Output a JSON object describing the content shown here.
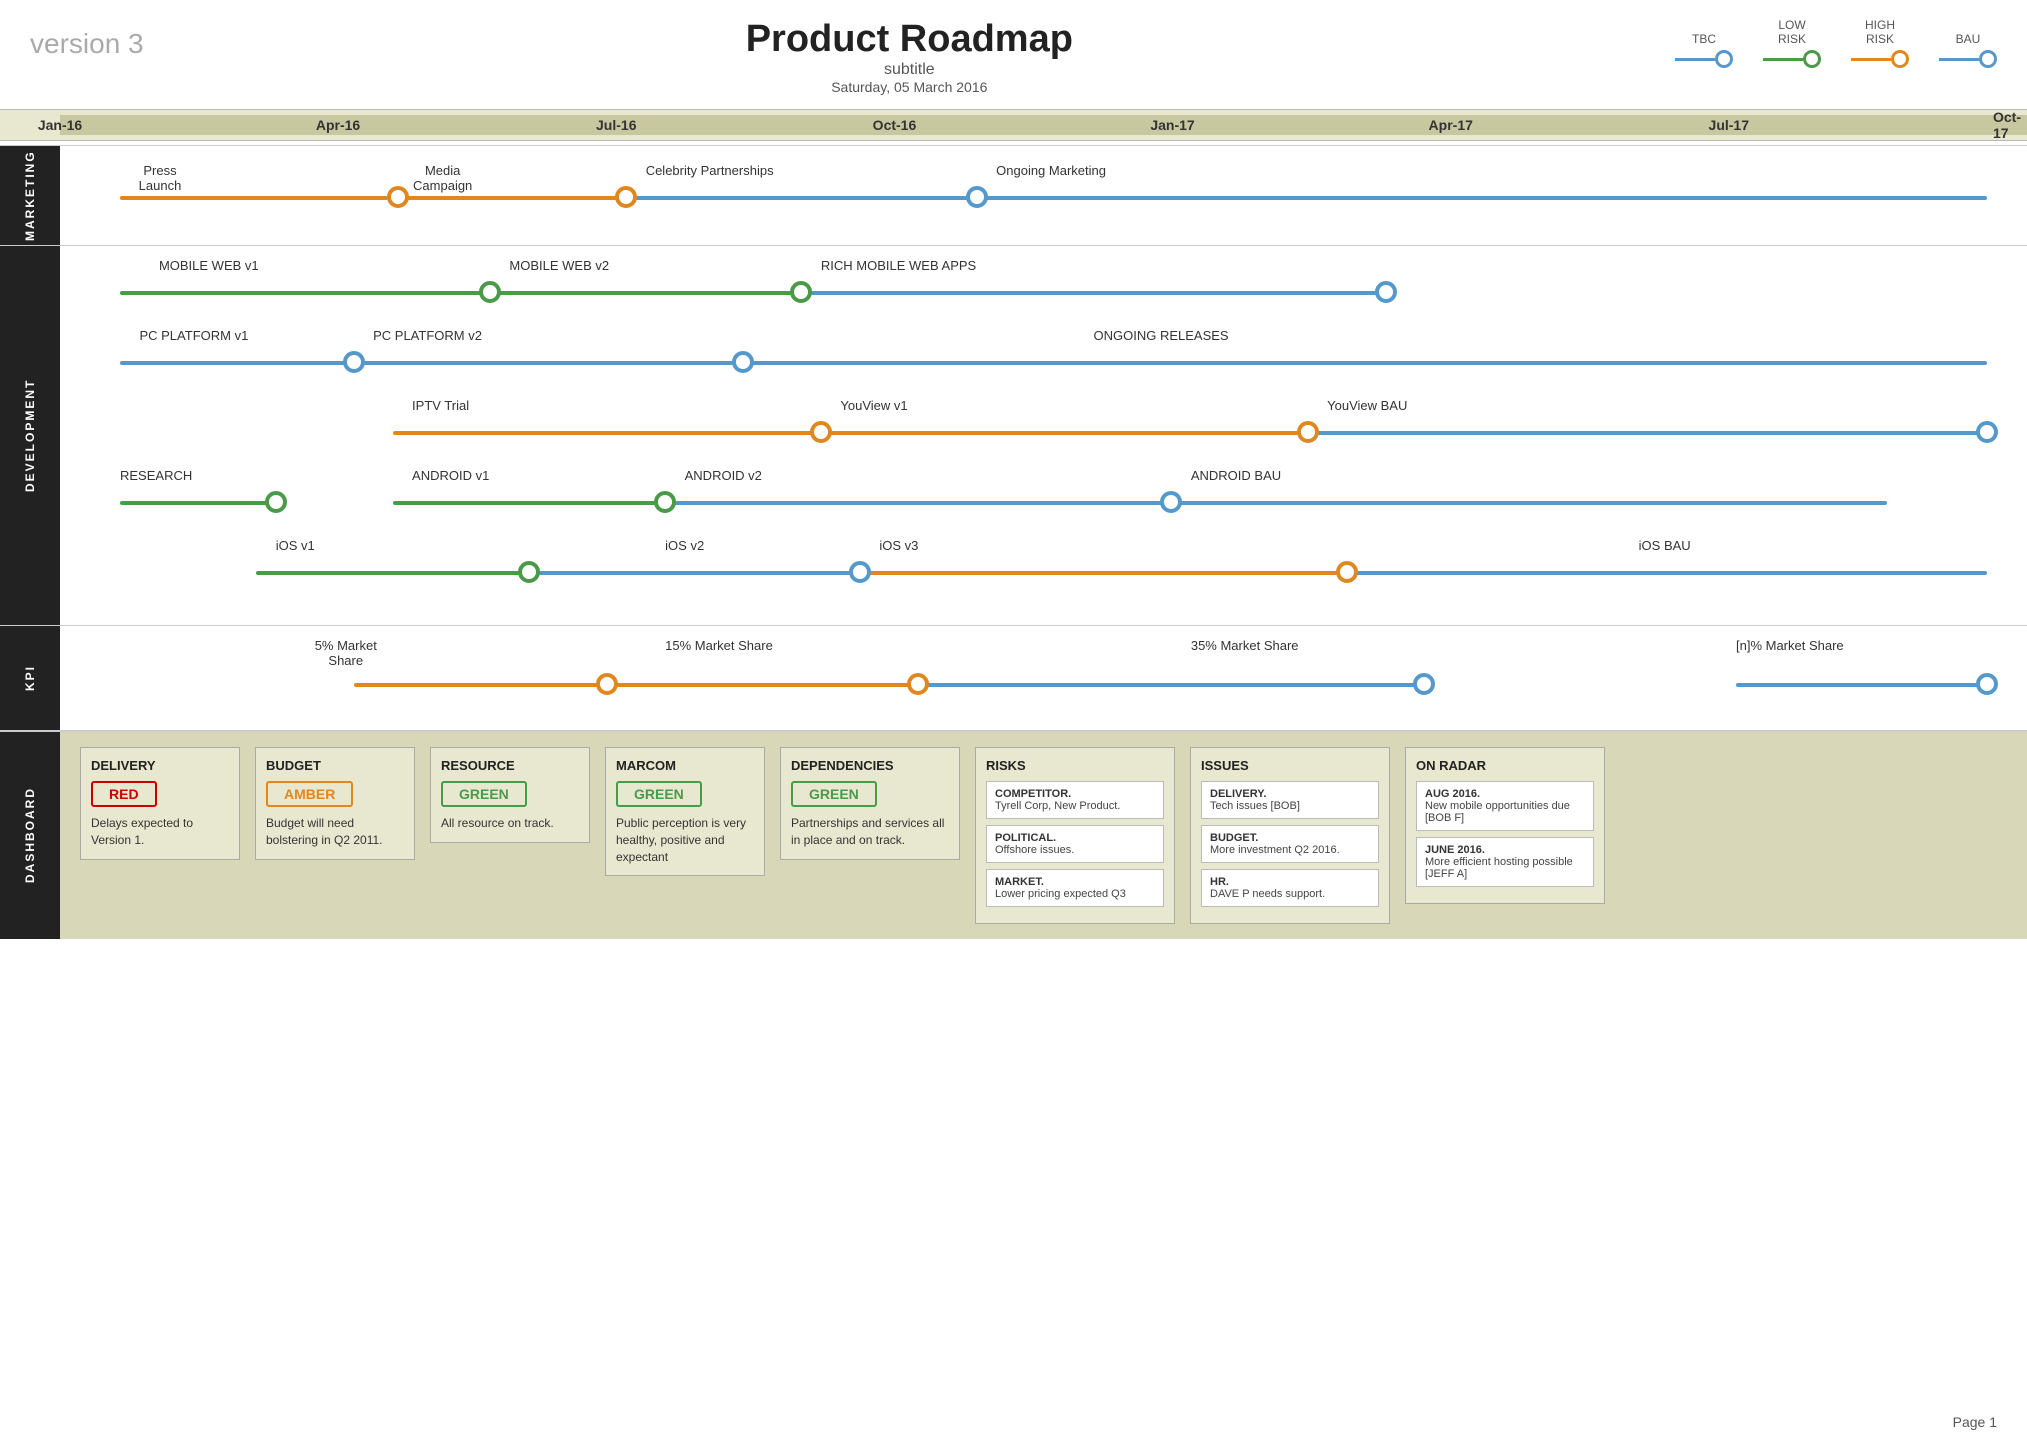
{
  "header": {
    "version": "version 3",
    "title": "Product Roadmap",
    "subtitle": "subtitle",
    "date": "Saturday, 05 March 2016"
  },
  "legend": {
    "items": [
      {
        "label": "TBC",
        "color": "#5599cc"
      },
      {
        "label": "LOW\nRISK",
        "color": "#4a9a4a"
      },
      {
        "label": "HIGH\nRISK",
        "color": "#e08820"
      },
      {
        "label": "BAU",
        "color": "#5599cc"
      }
    ]
  },
  "timeline": {
    "labels": [
      "Jan-16",
      "Apr-16",
      "Jul-16",
      "Oct-16",
      "Jan-17",
      "Apr-17",
      "Jul-17",
      "Oct-17"
    ]
  },
  "sections": {
    "marketing": {
      "label": "MARKETING",
      "lanes": [
        {
          "label": "Press\nLaunch",
          "label2": "Media\nCampaign",
          "label3": "Celebrity Partnerships",
          "label4": "Ongoing Marketing"
        }
      ]
    },
    "development": {
      "label": "DEVELOPMENT",
      "lanes": [
        {
          "label": "MOBILE WEB v1",
          "label2": "MOBILE WEB v2",
          "label3": "RICH MOBILE WEB APPS"
        },
        {
          "label": "PC PLATFORM v1",
          "label2": "PC PLATFORM v2",
          "label3": "ONGOING RELEASES"
        },
        {
          "label": "IPTV Trial",
          "label2": "YouView v1",
          "label3": "YouView BAU"
        },
        {
          "label": "RESEARCH",
          "label2": "ANDROID v1",
          "label3": "ANDROID v2",
          "label4": "ANDROID BAU"
        },
        {
          "label": "iOS v1",
          "label2": "iOS v2",
          "label3": "iOS v3",
          "label4": "iOS BAU"
        }
      ]
    },
    "kpi": {
      "label": "KPI",
      "lanes": [
        {
          "label": "5% Market\nShare",
          "label2": "15% Market Share",
          "label3": "35% Market Share",
          "label4": "[n]% Market Share"
        }
      ]
    }
  },
  "dashboard": {
    "label": "DASHBOARD",
    "cards": [
      {
        "title": "DELIVERY",
        "badge": "RED",
        "badge_type": "red",
        "text": "Delays expected to Version 1."
      },
      {
        "title": "BUDGET",
        "badge": "AMBER",
        "badge_type": "amber",
        "text": "Budget will need bolstering in Q2 2011."
      },
      {
        "title": "RESOURCE",
        "badge": "GREEN",
        "badge_type": "green",
        "text": "All resource on track."
      },
      {
        "title": "MARCOM",
        "badge": "GREEN",
        "badge_type": "green",
        "text": "Public perception is very healthy, positive and expectant"
      },
      {
        "title": "DEPENDENCIES",
        "badge": "GREEN",
        "badge_type": "green",
        "text": "Partnerships and services all in place and on track."
      },
      {
        "title": "RISKS",
        "sub_items": [
          {
            "title": "COMPETITOR.",
            "text": "Tyrell Corp, New Product."
          },
          {
            "title": "POLITICAL.",
            "text": "Offshore issues."
          },
          {
            "title": "MARKET.",
            "text": "Lower pricing expected Q3"
          }
        ]
      },
      {
        "title": "ISSUES",
        "sub_items": [
          {
            "title": "DELIVERY.",
            "text": "Tech issues [BOB]"
          },
          {
            "title": "BUDGET.",
            "text": "More investment Q2 2016."
          },
          {
            "title": "HR.",
            "text": "DAVE P needs support."
          }
        ]
      },
      {
        "title": "ON RADAR",
        "sub_items": [
          {
            "title": "AUG 2016.",
            "text": "New mobile opportunities due [BOB F]"
          },
          {
            "title": "JUNE 2016.",
            "text": "More efficient hosting possible [JEFF A]"
          }
        ]
      }
    ]
  },
  "page": "Page 1"
}
